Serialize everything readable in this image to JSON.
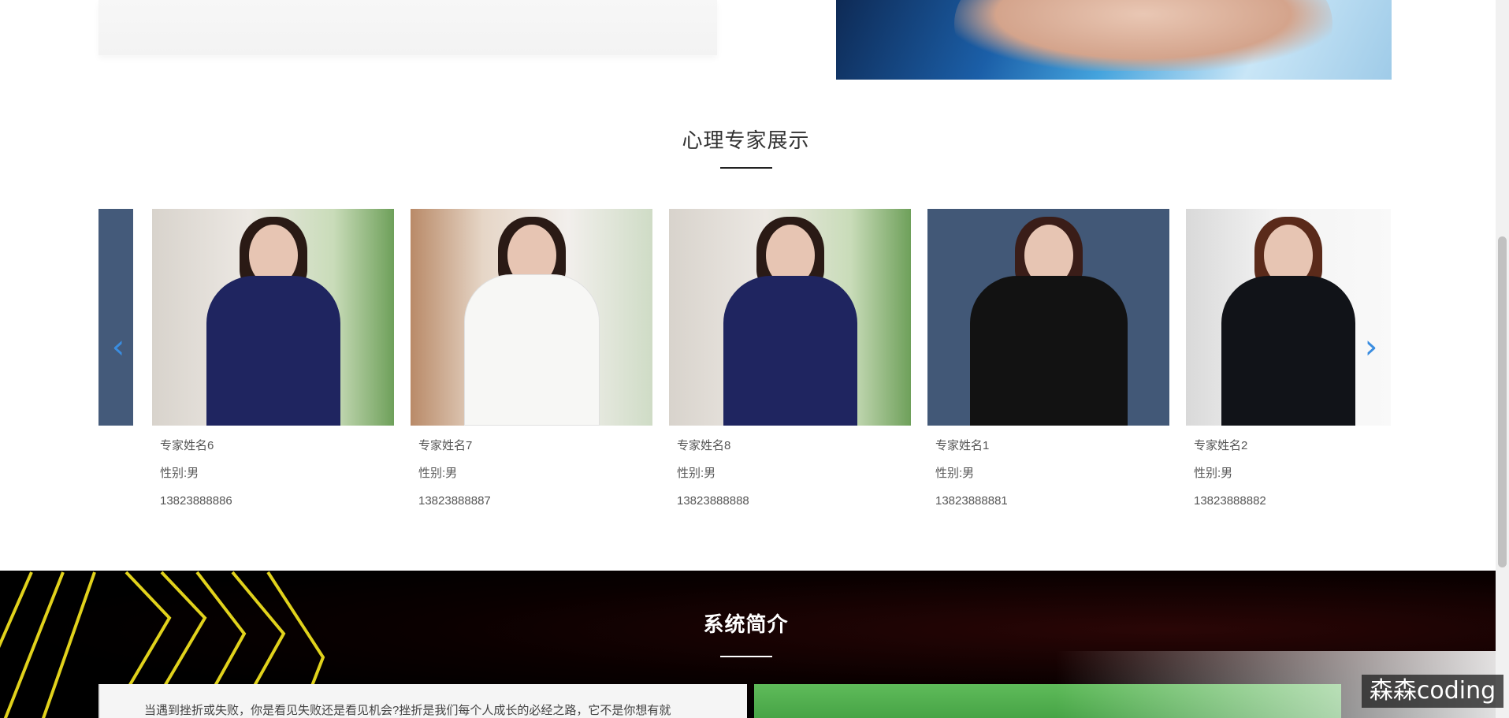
{
  "experts_section": {
    "title": "心理专家展示",
    "cards": [
      {
        "name": "专家姓名6",
        "gender": "性别:男",
        "phone": "13823888886",
        "outfit": "navy-suit"
      },
      {
        "name": "专家姓名7",
        "gender": "性别:男",
        "phone": "13823888887",
        "outfit": "white-blouse"
      },
      {
        "name": "专家姓名8",
        "gender": "性别:男",
        "phone": "13823888888",
        "outfit": "navy-suit"
      },
      {
        "name": "专家姓名1",
        "gender": "性别:男",
        "phone": "13823888881",
        "outfit": "black-shirt"
      },
      {
        "name": "专家姓名2",
        "gender": "性别:男",
        "phone": "13823888882",
        "outfit": "black-suit"
      }
    ],
    "prev_arrow": "‹",
    "next_arrow": "›"
  },
  "intro_section": {
    "title": "系统简介",
    "text": "当遇到挫折或失败，你是看见失败还是看见机会?挫折是我们每个人成长的必经之路，它不是你想有就"
  },
  "watermark": "森森coding",
  "colors": {
    "accent_blue": "#3a8de0",
    "dark_section": "#000000",
    "chevron_yellow": "#e1d21c"
  }
}
